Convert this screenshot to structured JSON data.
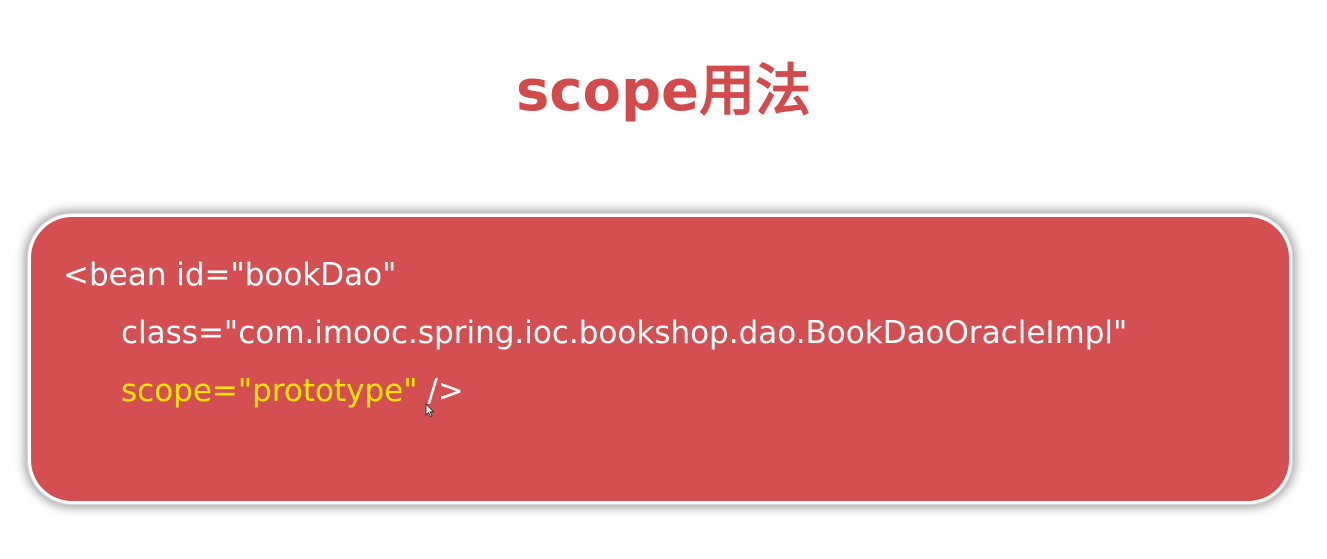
{
  "slide": {
    "title": "scope用法"
  },
  "code": {
    "line1": "<bean id=\"bookDao\"",
    "line2": "class=\"com.imooc.spring.ioc.bookshop.dao.BookDaoOracleImpl\"",
    "line3_highlight": "scope=\"prototype\"",
    "line3_rest": " />"
  },
  "colors": {
    "title": "#d24a4c",
    "card_background": "#d34f51",
    "code_text": "#ffffff",
    "highlight_text": "#ffe600"
  },
  "icons": {
    "cursor": "mouse-pointer-icon"
  }
}
